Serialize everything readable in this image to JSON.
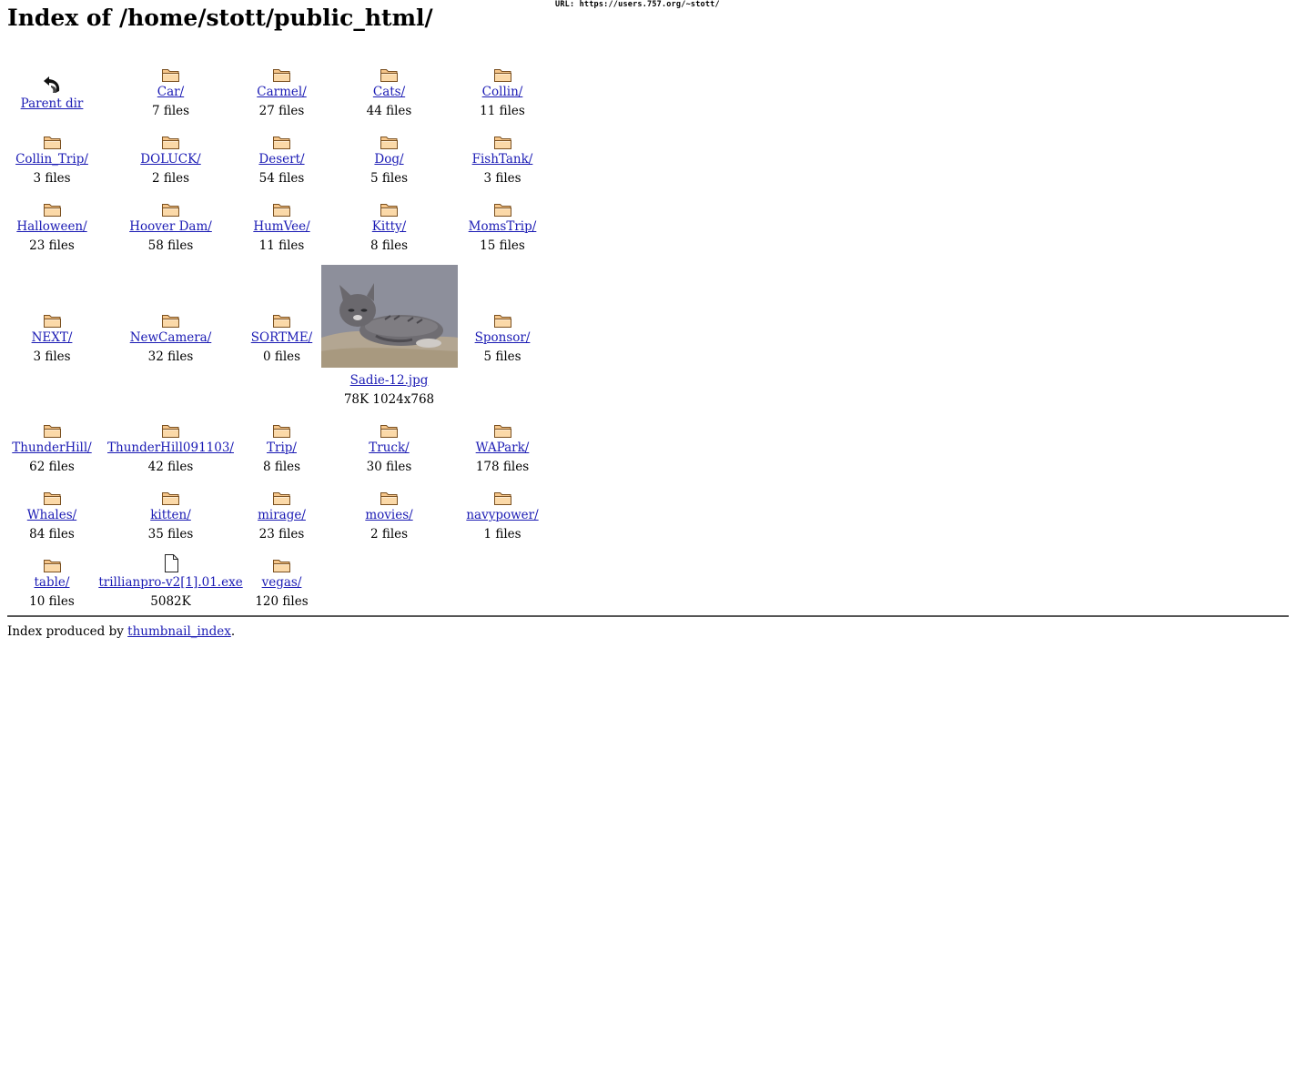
{
  "url_text": "URL: https://users.757.org/~stott/",
  "title": "Index of /home/stott/public_html/",
  "rows": [
    [
      {
        "type": "parent",
        "label": "Parent dir",
        "info": ""
      },
      {
        "type": "folder",
        "label": "Car/",
        "info": "7 files"
      },
      {
        "type": "folder",
        "label": "Carmel/",
        "info": "27 files"
      },
      {
        "type": "folder",
        "label": "Cats/",
        "info": "44 files"
      },
      {
        "type": "folder",
        "label": "Collin/",
        "info": "11 files"
      }
    ],
    [
      {
        "type": "folder",
        "label": "Collin_Trip/",
        "info": "3 files"
      },
      {
        "type": "folder",
        "label": "DOLUCK/",
        "info": "2 files"
      },
      {
        "type": "folder",
        "label": "Desert/",
        "info": "54 files"
      },
      {
        "type": "folder",
        "label": "Dog/",
        "info": "5 files"
      },
      {
        "type": "folder",
        "label": "FishTank/",
        "info": "3 files"
      }
    ],
    [
      {
        "type": "folder",
        "label": "Halloween/",
        "info": "23 files"
      },
      {
        "type": "folder",
        "label": "Hoover Dam/",
        "info": "58 files"
      },
      {
        "type": "folder",
        "label": "HumVee/",
        "info": "11 files"
      },
      {
        "type": "folder",
        "label": "Kitty/",
        "info": "8 files"
      },
      {
        "type": "folder",
        "label": "MomsTrip/",
        "info": "15 files"
      }
    ],
    [
      {
        "type": "folder",
        "label": "NEXT/",
        "info": "3 files"
      },
      {
        "type": "folder",
        "label": "NewCamera/",
        "info": "32 files"
      },
      {
        "type": "folder",
        "label": "SORTME/",
        "info": "0 files"
      },
      {
        "type": "image",
        "label": "Sadie-12.jpg",
        "info": "78K 1024x768"
      },
      {
        "type": "folder",
        "label": "Sponsor/",
        "info": "5 files"
      }
    ],
    [
      {
        "type": "folder",
        "label": "ThunderHill/",
        "info": "62 files"
      },
      {
        "type": "folder",
        "label": "ThunderHill091103/",
        "info": "42 files"
      },
      {
        "type": "folder",
        "label": "Trip/",
        "info": "8 files"
      },
      {
        "type": "folder",
        "label": "Truck/",
        "info": "30 files"
      },
      {
        "type": "folder",
        "label": "WAPark/",
        "info": "178 files"
      }
    ],
    [
      {
        "type": "folder",
        "label": "Whales/",
        "info": "84 files"
      },
      {
        "type": "folder",
        "label": "kitten/",
        "info": "35 files"
      },
      {
        "type": "folder",
        "label": "mirage/",
        "info": "23 files"
      },
      {
        "type": "folder",
        "label": "movies/",
        "info": "2 files"
      },
      {
        "type": "folder",
        "label": "navypower/",
        "info": "1 files"
      }
    ],
    [
      {
        "type": "folder",
        "label": "table/",
        "info": "10 files"
      },
      {
        "type": "file",
        "label": "trillianpro-v2[1].01.exe",
        "info": "5082K"
      },
      {
        "type": "folder",
        "label": "vegas/",
        "info": "120 files"
      }
    ]
  ],
  "footer": {
    "prefix": "Index produced by ",
    "link": "thumbnail_index",
    "suffix": "."
  },
  "colors": {
    "link": "#1a1ab4",
    "folder_fill": "#f6c68a",
    "folder_stroke": "#7a5020"
  },
  "icons": {
    "parent": "back-arrow-icon",
    "folder": "folder-icon",
    "file": "document-icon",
    "image": "kitten-photo-thumbnail"
  }
}
